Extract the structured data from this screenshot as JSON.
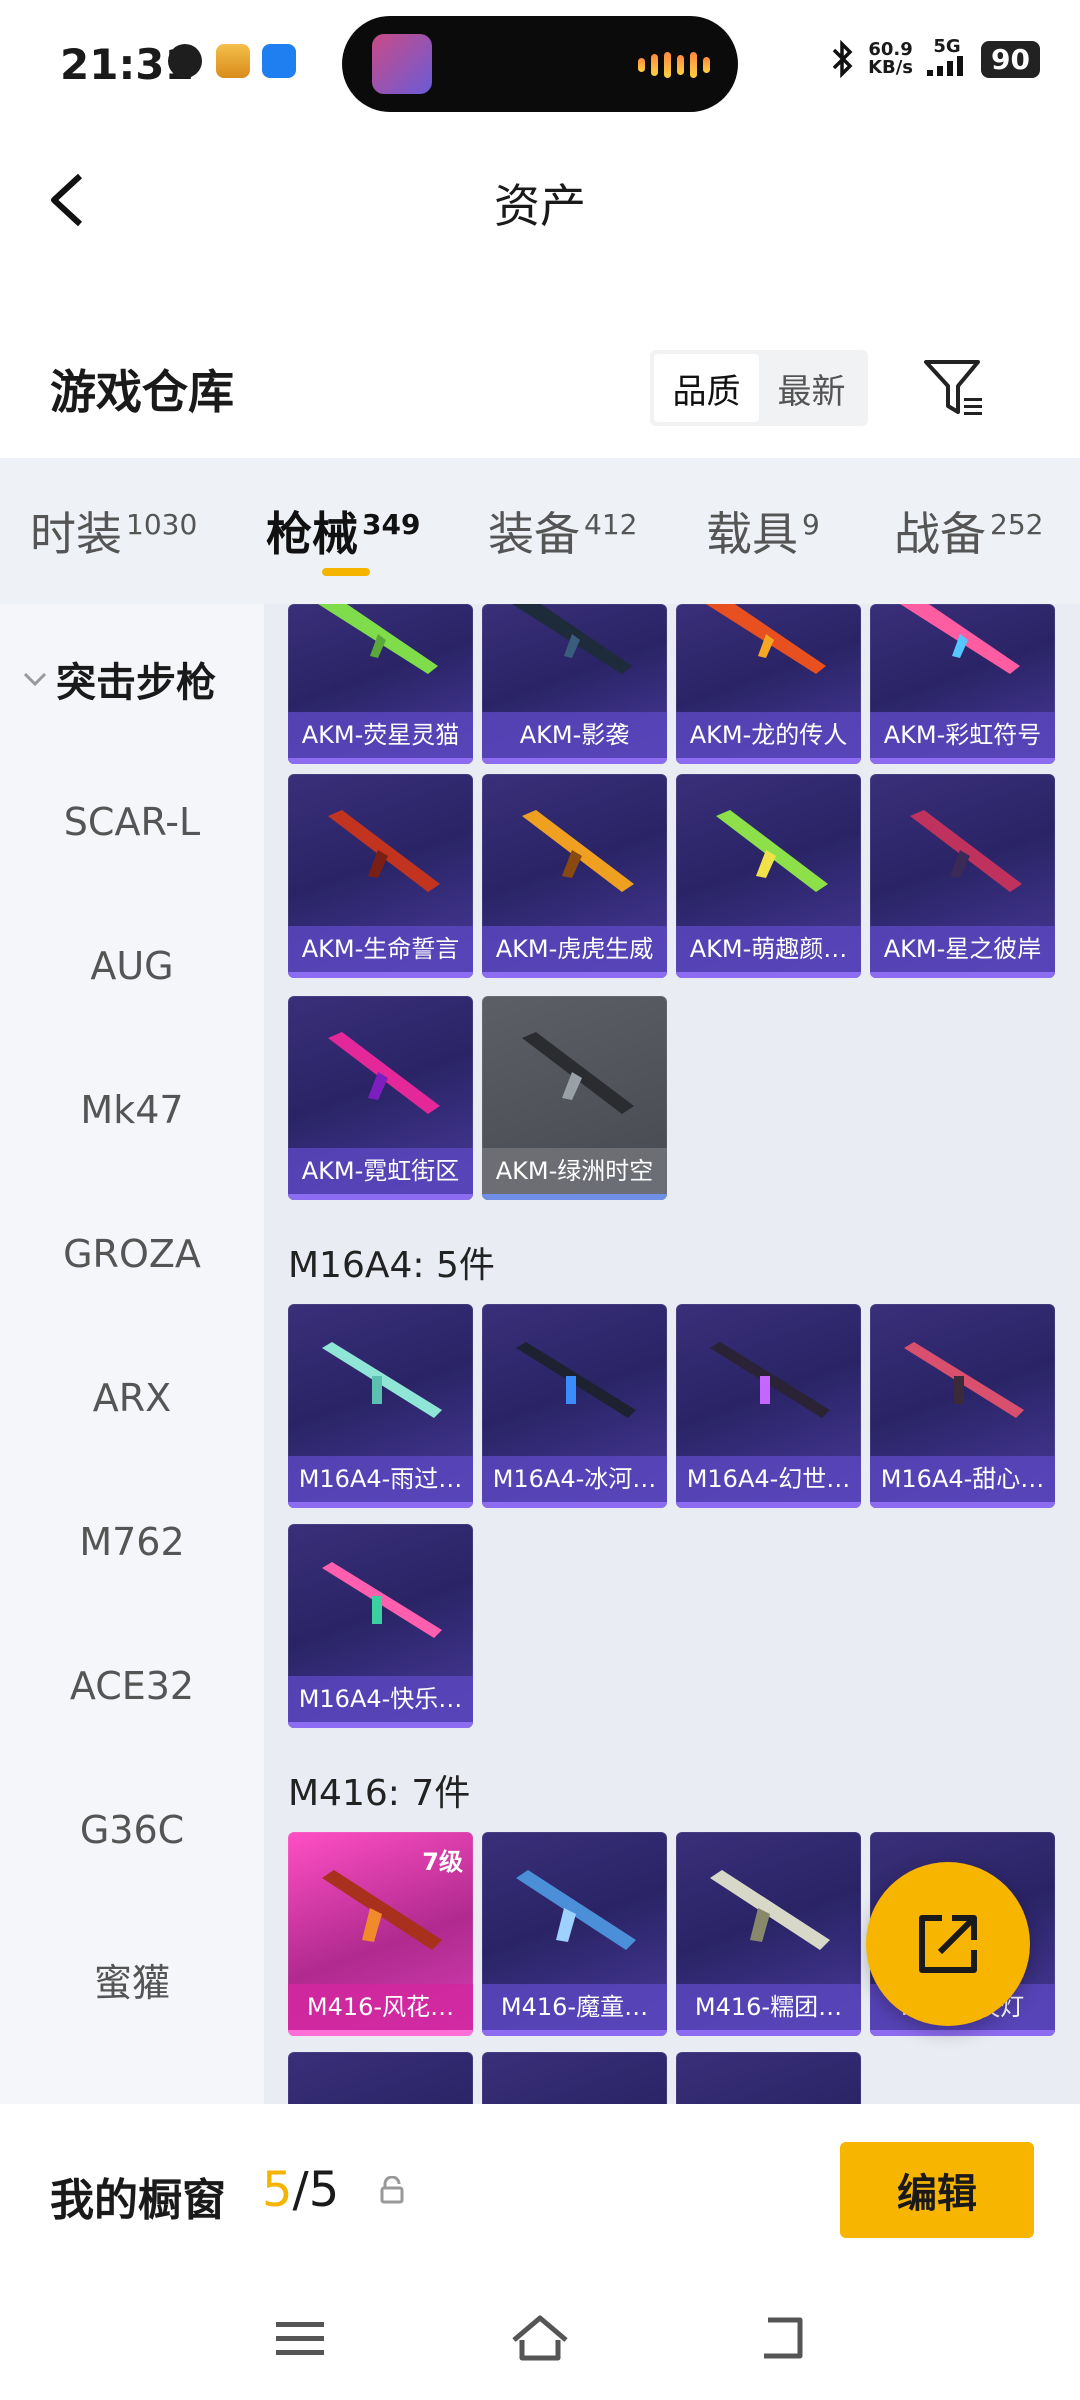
{
  "status_bar": {
    "time": "21:31",
    "net_speed_value": "60.9",
    "net_speed_unit": "KB/s",
    "network": "5G",
    "battery": "90"
  },
  "header": {
    "title": "资产"
  },
  "warehouse": {
    "title": "游戏仓库",
    "sort_options": [
      "品质",
      "最新"
    ],
    "sort_active": "品质"
  },
  "tabs": [
    {
      "label": "时装",
      "count": "1030"
    },
    {
      "label": "枪械",
      "count": "349"
    },
    {
      "label": "装备",
      "count": "412"
    },
    {
      "label": "载具",
      "count": "9"
    },
    {
      "label": "战备",
      "count": "252"
    }
  ],
  "active_tab": "枪械",
  "sidebar": {
    "category": "突击步枪",
    "items": [
      "SCAR-L",
      "AUG",
      "Mk47",
      "GROZA",
      "ARX",
      "M762",
      "ACE32",
      "G36C",
      "蜜獾"
    ]
  },
  "sections": {
    "akm_items": [
      "AKM-荧星灵猫",
      "AKM-影袭",
      "AKM-龙的传人",
      "AKM-彩虹符号",
      "AKM-生命誓言",
      "AKM-虎虎生威",
      "AKM-萌趣颜…",
      "AKM-星之彼岸",
      "AKM-霓虹街区",
      "AKM-绿洲时空"
    ],
    "m16_title": "M16A4: 5件",
    "m16_items": [
      "M16A4-雨过…",
      "M16A4-冰河…",
      "M16A4-幻世…",
      "M16A4-甜心…",
      "M16A4-快乐…"
    ],
    "m416_title": "M416: 7件",
    "m416_items": [
      "M416-风花…",
      "M416-魔童…",
      "M416-糯团…",
      "M416-夜灯"
    ],
    "m416_level": "7级"
  },
  "showcase": {
    "label": "我的橱窗",
    "current": "5",
    "separator": "/",
    "total": "5",
    "edit_label": "编辑"
  },
  "colors": {
    "accent": "#f7b500",
    "card_purple": "#3a2f7a"
  }
}
